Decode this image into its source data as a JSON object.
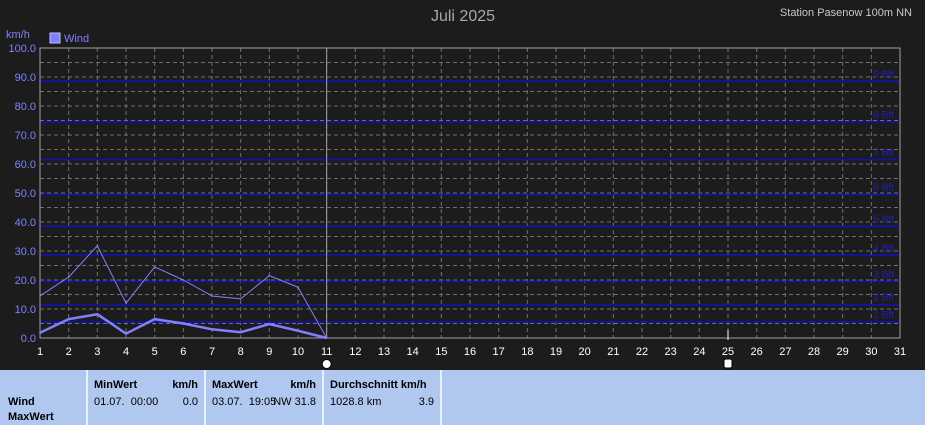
{
  "title": "Juli 2025",
  "station": "Station Pasenow 100m NN",
  "y_unit": "km/h",
  "legend": {
    "label": "Wind",
    "color": "#8080ff"
  },
  "summary": {
    "row_labels": [
      "Wind",
      "MaxWert"
    ],
    "min": {
      "header_left": "MinWert",
      "header_right": "km/h",
      "date": "01.07.  00:00",
      "value": "0.0"
    },
    "max": {
      "header_left": "MaxWert",
      "header_right": "km/h",
      "date": "03.07.  19:05",
      "dir_value": "NW 31.8"
    },
    "avg": {
      "header_left": "Durchschnitt km/h",
      "distance": "1028.8 km",
      "value": "3.9"
    }
  },
  "chart_data": {
    "type": "line",
    "title": "Juli 2025",
    "ylabel": "km/h",
    "xlim": [
      1,
      31
    ],
    "ylim": [
      0,
      100
    ],
    "x_ticks": [
      "1",
      "2",
      "3",
      "4",
      "5",
      "6",
      "7",
      "8",
      "9",
      "10",
      "11",
      "12",
      "13",
      "14",
      "15",
      "16",
      "17",
      "18",
      "19",
      "20",
      "21",
      "22",
      "23",
      "24",
      "25",
      "26",
      "27",
      "28",
      "29",
      "30",
      "31"
    ],
    "y_ticks": [
      "0.0",
      "10.0",
      "20.0",
      "30.0",
      "40.0",
      "50.0",
      "60.0",
      "70.0",
      "80.0",
      "90.0",
      "100.0"
    ],
    "grid": true,
    "legend_position": "top-left",
    "series": [
      {
        "name": "Wind",
        "style": "max",
        "color": "#8080ff",
        "x": [
          1,
          2,
          3,
          4,
          5,
          6,
          7,
          8,
          9,
          10,
          11
        ],
        "values": [
          14.5,
          21,
          31.8,
          12,
          24.5,
          20,
          14.5,
          13.5,
          21.5,
          17.5,
          0
        ]
      },
      {
        "style": "avg",
        "color": "#8080ff",
        "x": [
          1,
          2,
          3,
          4,
          5,
          6,
          7,
          8,
          9,
          10,
          11
        ],
        "values": [
          1.8,
          6.5,
          8.2,
          1.5,
          6.5,
          5,
          3,
          2,
          4.8,
          2.5,
          0
        ]
      }
    ],
    "beaufort": [
      {
        "label": "1 Bft",
        "value": 5.5
      },
      {
        "label": "2 Bft",
        "value": 11.5
      },
      {
        "label": "3 Bft",
        "value": 19.5
      },
      {
        "label": "4 Bft",
        "value": 28.5
      },
      {
        "label": "5 Bft",
        "value": 38.5
      },
      {
        "label": "6 Bft",
        "value": 49.5
      },
      {
        "label": "7 Bft",
        "value": 61.5
      },
      {
        "label": "8 Bft",
        "value": 74.5
      },
      {
        "label": "9 Bft",
        "value": 88.5
      }
    ],
    "current_day_marker": 11,
    "markers": [
      {
        "day": 11,
        "shape": "circle"
      },
      {
        "day": 25,
        "shape": "square"
      }
    ],
    "beaufort_line_color": "#1010c0",
    "grid_color": "#707070"
  }
}
